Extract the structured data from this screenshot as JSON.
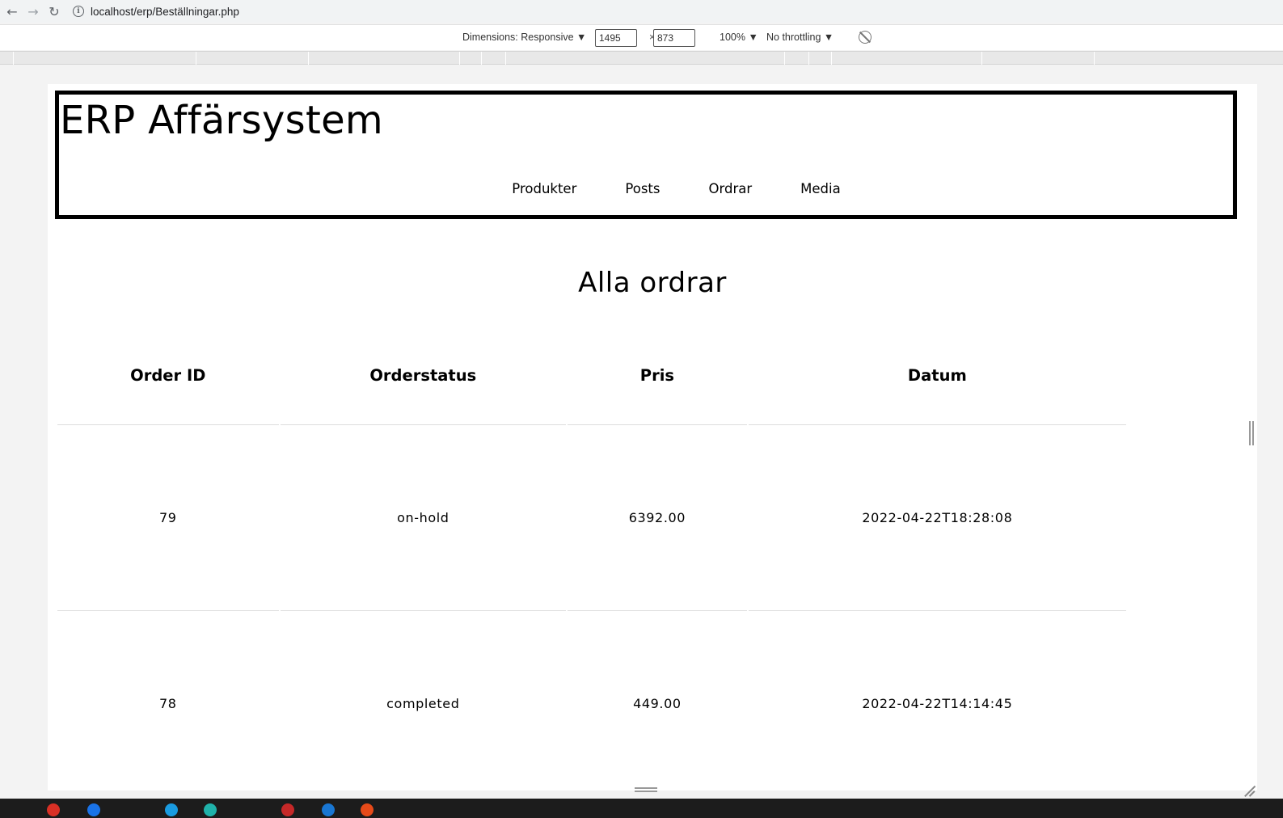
{
  "browser": {
    "url": "localhost/erp/Beställningar.php"
  },
  "devtools": {
    "dimensions_label": "Dimensions: Responsive ▼",
    "width_value": "1495",
    "times": "×",
    "height_value": "873",
    "zoom": "100% ▼",
    "throttling": "No throttling ▼"
  },
  "site": {
    "title": "ERP Affärsystem",
    "nav": [
      "Produkter",
      "Posts",
      "Ordrar",
      "Media"
    ]
  },
  "page": {
    "heading": "Alla ordrar"
  },
  "table": {
    "columns": [
      "Order ID",
      "Orderstatus",
      "Pris",
      "Datum"
    ],
    "rows": [
      [
        "79",
        "on-hold",
        "6392.00",
        "2022-04-22T18:28:08"
      ],
      [
        "78",
        "completed",
        "449.00",
        "2022-04-22T14:14:45"
      ]
    ]
  }
}
